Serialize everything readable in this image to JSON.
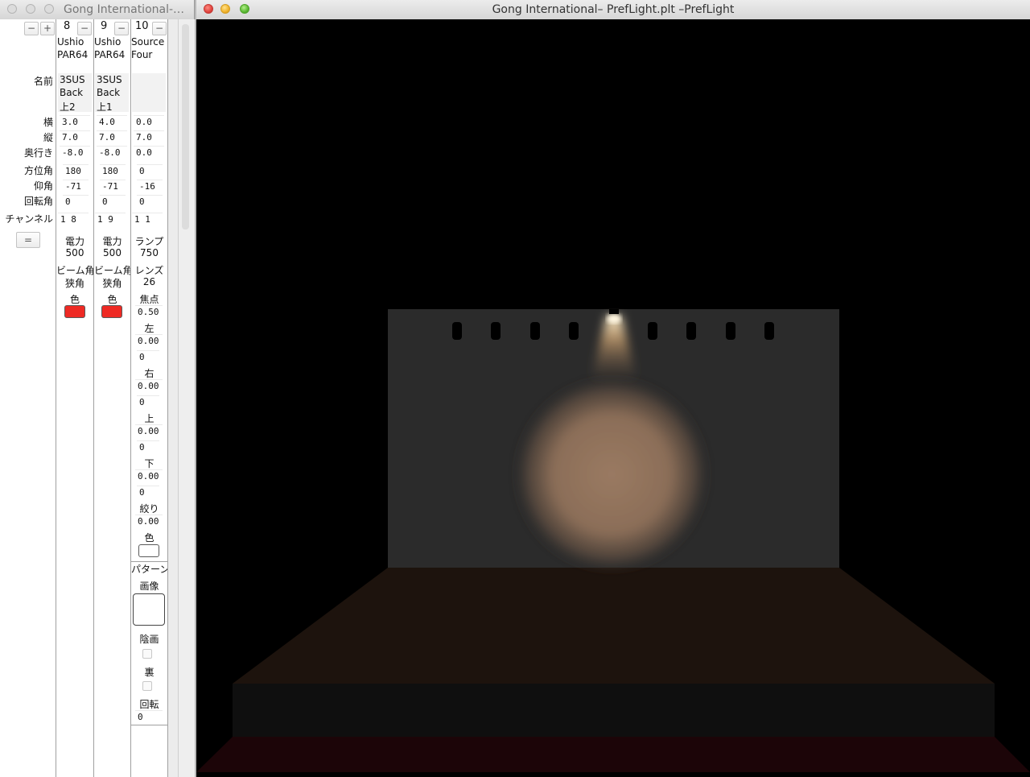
{
  "left_window": {
    "title": "Gong International-…",
    "buttons": {
      "minus": "−",
      "plus": "+",
      "equals": "="
    },
    "row_labels": {
      "name": "名前",
      "x": "横",
      "y": "縦",
      "z": "奥行き",
      "azimuth": "方位角",
      "elevation": "仰角",
      "rotation": "回転角",
      "channel": "チャンネル"
    },
    "fixtures": [
      {
        "number": "8",
        "type_line1": "Ushio",
        "type_line2": "PAR64",
        "name_line1": "3SUS",
        "name_line2": "Back",
        "name_line3": "上2",
        "x": "3.0",
        "y": "7.0",
        "z": "-8.0",
        "azimuth": "180",
        "elevation": "-71",
        "rotation": "0",
        "channel": "1 8",
        "power_label": "電力",
        "power": "500",
        "beam_label": "ビーム角",
        "beam": "狭角",
        "color_label": "色",
        "color": "#ee2a24"
      },
      {
        "number": "9",
        "type_line1": "Ushio",
        "type_line2": "PAR64",
        "name_line1": "3SUS",
        "name_line2": "Back",
        "name_line3": "上1",
        "x": "4.0",
        "y": "7.0",
        "z": "-8.0",
        "azimuth": "180",
        "elevation": "-71",
        "rotation": "0",
        "channel": "1 9",
        "power_label": "電力",
        "power": "500",
        "beam_label": "ビーム角",
        "beam": "狭角",
        "color_label": "色",
        "color": "#ee2a24"
      },
      {
        "number": "10",
        "type_line1": "Source",
        "type_line2": "Four",
        "x": "0.0",
        "y": "7.0",
        "z": "0.0",
        "azimuth": "0",
        "elevation": "-16",
        "rotation": "0",
        "channel": "1 1",
        "lamp_label": "ランプ",
        "lamp": "750",
        "lens_label": "レンズ",
        "lens": "26",
        "focus_label": "焦点",
        "focus": "0.50",
        "left_label": "左",
        "left_value": "0.00",
        "left_angle": "0",
        "right_label": "右",
        "right_value": "0.00",
        "right_angle": "0",
        "top_label": "上",
        "top_value": "0.00",
        "top_angle": "0",
        "bottom_label": "下",
        "bottom_value": "0.00",
        "bottom_angle": "0",
        "iris_label": "絞り",
        "iris": "0.00",
        "color_label": "色",
        "color": "#ffffff",
        "pattern_label": "パターン",
        "image_label": "画像",
        "shading_label": "陰画",
        "reverse_label": "裏",
        "rotate_label": "回転",
        "rotate": "0"
      }
    ]
  },
  "right_window": {
    "title": "Gong International– PrefLight.plt –PrefLight"
  }
}
